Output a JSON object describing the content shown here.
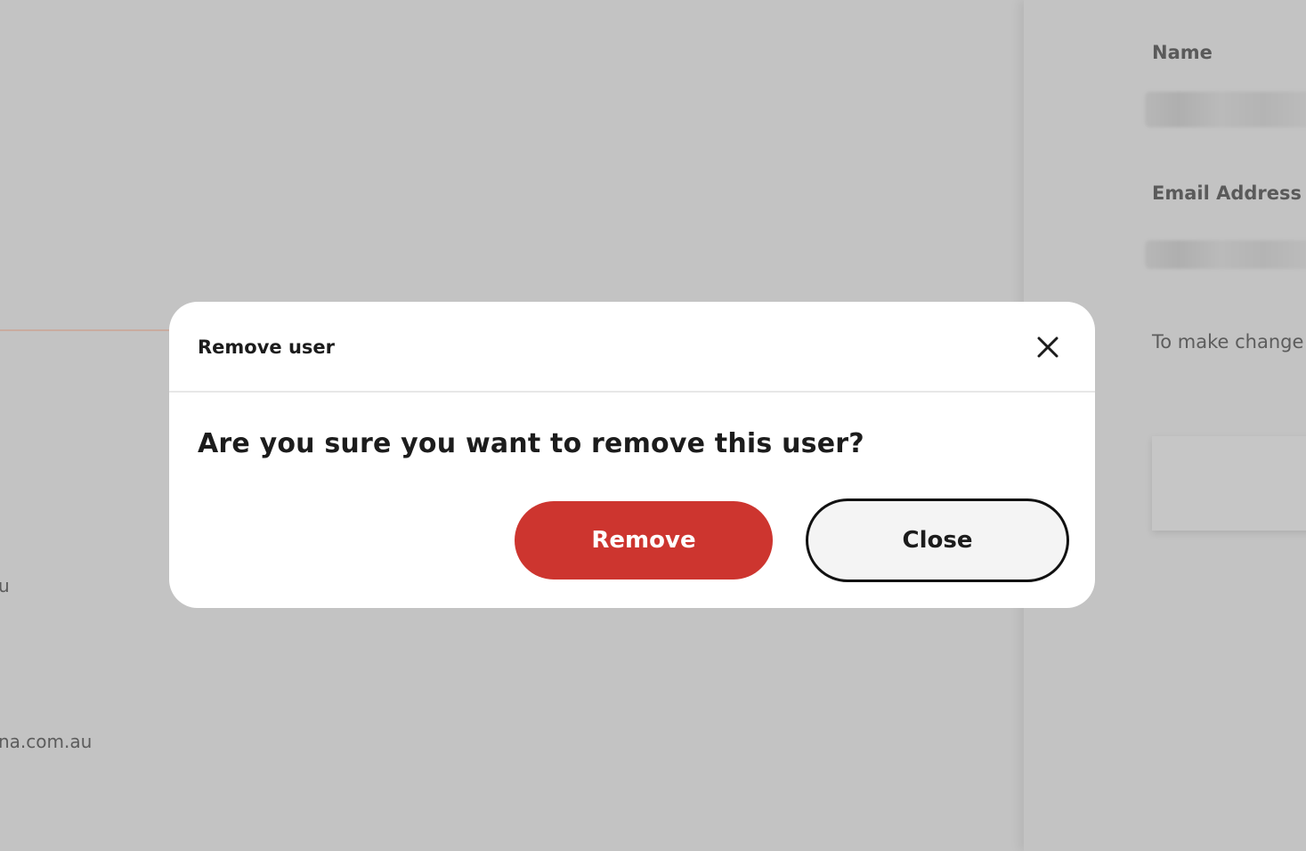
{
  "background": {
    "partial_text_1": "u",
    "partial_text_2": "na.com.au"
  },
  "side_panel": {
    "name_label": "Name",
    "email_label": "Email Address",
    "hint_text": "To make change"
  },
  "modal": {
    "title": "Remove user",
    "close_icon": "close-x-icon",
    "question": "Are you sure you want to remove this user?",
    "remove_label": "Remove",
    "close_label": "Close"
  },
  "colors": {
    "overlay": "#c3c3c3",
    "danger": "#cd352f",
    "text": "#1c1c1c"
  }
}
